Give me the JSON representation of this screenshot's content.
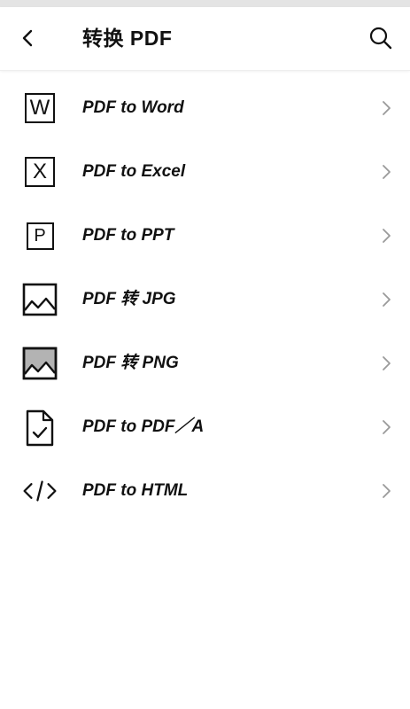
{
  "header": {
    "title": "转换 PDF"
  },
  "icons": {
    "back": "chevron-left-icon",
    "search": "search-icon",
    "row_chevron": "chevron-right-icon"
  },
  "items": [
    {
      "label": "PDF to Word",
      "icon": "word-icon",
      "icon_letter": "W"
    },
    {
      "label": "PDF to Excel",
      "icon": "excel-icon",
      "icon_letter": "X"
    },
    {
      "label": "PDF to PPT",
      "icon": "ppt-icon",
      "icon_letter": "P"
    },
    {
      "label": "PDF 转 JPG",
      "icon": "image-outline-icon"
    },
    {
      "label": "PDF 转 PNG",
      "icon": "image-filled-icon"
    },
    {
      "label": "PDF to PDF／A",
      "icon": "document-check-icon"
    },
    {
      "label": "PDF to HTML",
      "icon": "code-icon"
    }
  ],
  "colors": {
    "text": "#111111",
    "chevron": "#9a9a9a",
    "status_strip": "#e4e4e4",
    "png_fill": "#b3b3b3"
  }
}
